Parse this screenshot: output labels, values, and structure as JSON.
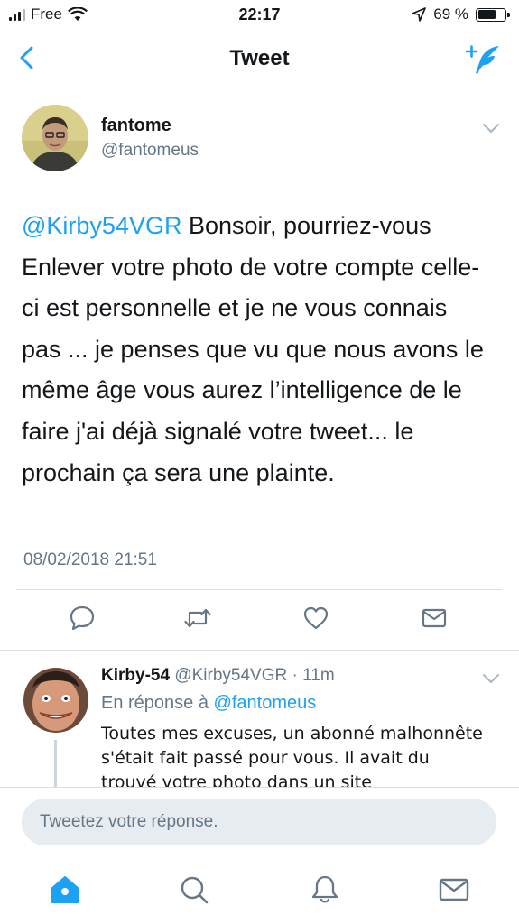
{
  "status_bar": {
    "carrier": "Free",
    "time": "22:17",
    "battery": "69 %",
    "battery_level": 0.69
  },
  "nav": {
    "title": "Tweet"
  },
  "tweet": {
    "name": "fantome",
    "handle": "@fantomeus",
    "mention": "@Kirby54VGR",
    "text": " Bonsoir, pourriez-vous Enlever votre photo de votre compte celle-ci est personnelle et je ne vous connais pas ... je penses que vu que nous avons le même âge vous aurez l’intelligence  de le faire j'ai déjà signalé votre tweet... le prochain ça sera une plainte.",
    "date": "08/02/2018 21:51"
  },
  "reply": {
    "name": "Kirby-54",
    "handle": "@Kirby54VGR",
    "separator": " · ",
    "time": "11m",
    "in_reply_prefix": "En réponse à ",
    "in_reply_handle": "@fantomeus",
    "text": "Toutes mes excuses, un abonné malhonnête s'était fait passé pour vous. Il avait du trouvé votre photo dans un site"
  },
  "compose": {
    "placeholder": "Tweetez votre réponse."
  },
  "icons": {
    "back": "chevron-left-icon",
    "compose": "compose-tweet-icon",
    "reply": "reply-icon",
    "retweet": "retweet-icon",
    "like": "heart-icon",
    "dm": "envelope-icon",
    "home": "home-icon",
    "search": "search-icon",
    "notifications": "bell-icon",
    "messages": "envelope-icon"
  },
  "colors": {
    "accent": "#1da1f2",
    "secondary_text": "#657786",
    "divider": "#d9dee2"
  }
}
